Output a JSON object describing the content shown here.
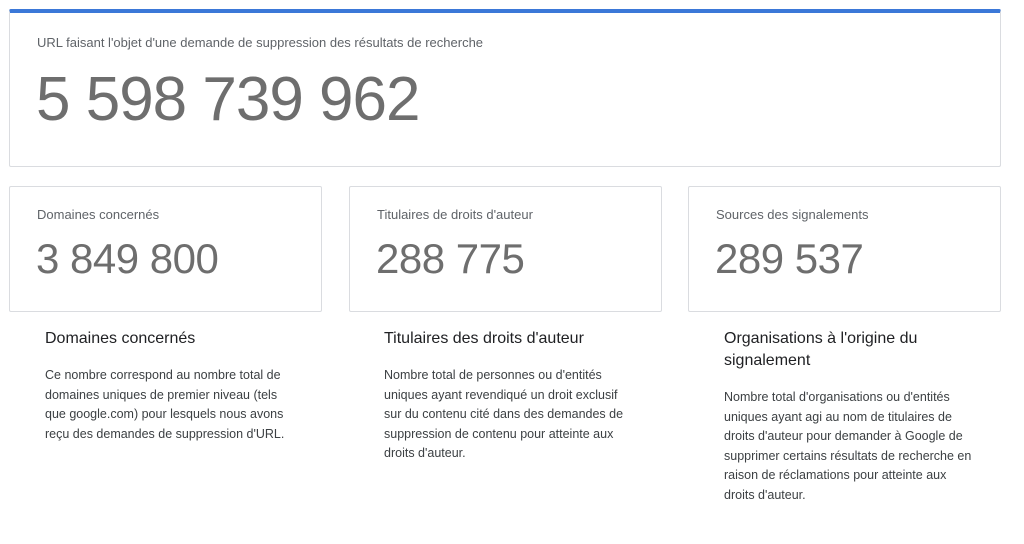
{
  "summary": {
    "label": "URL faisant l'objet d'une demande de suppression des résultats de recherche",
    "value": "5 598 739 962"
  },
  "stats": [
    {
      "label": "Domaines concernés",
      "value": "3 849 800"
    },
    {
      "label": "Titulaires de droits d'auteur",
      "value": "288 775"
    },
    {
      "label": "Sources des signalements",
      "value": "289 537"
    }
  ],
  "descriptions": [
    {
      "title": "Domaines concernés",
      "body": "Ce nombre correspond au nombre total de domaines uniques de premier niveau (tels que google.com) pour lesquels nous avons reçu des demandes de suppression d'URL."
    },
    {
      "title": "Titulaires des droits d'auteur",
      "body": "Nombre total de personnes ou d'entités uniques ayant revendiqué un droit exclusif sur du contenu cité dans des demandes de suppression de contenu pour atteinte aux droits d'auteur."
    },
    {
      "title": "Organisations à l'origine du signalement",
      "body": "Nombre total d'organisations ou d'entités uniques ayant agi au nom de titulaires de droits d'auteur pour demander à Google de supprimer certains résultats de recherche en raison de réclamations pour atteinte aux droits d'auteur."
    }
  ],
  "colors": {
    "accent": "#3b78d8",
    "number": "#6e6e6e",
    "border": "#dadce0"
  }
}
